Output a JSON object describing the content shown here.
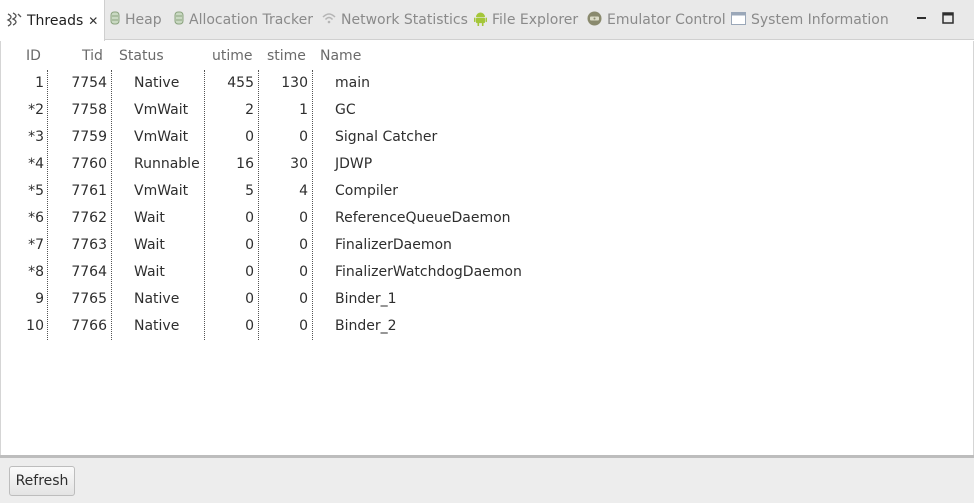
{
  "tabs": [
    {
      "label": "Threads",
      "icon": "threads-icon"
    },
    {
      "label": "Heap",
      "icon": "heap-icon"
    },
    {
      "label": "Allocation Tracker",
      "icon": "allocation-tracker-icon"
    },
    {
      "label": "Network Statistics",
      "icon": "network-statistics-icon"
    },
    {
      "label": "File Explorer",
      "icon": "android-icon"
    },
    {
      "label": "Emulator Control",
      "icon": "emulator-control-icon"
    },
    {
      "label": "System Information",
      "icon": "system-information-icon"
    }
  ],
  "columns": {
    "id": "ID",
    "tid": "Tid",
    "status": "Status",
    "utime": "utime",
    "stime": "stime",
    "name": "Name"
  },
  "rows": [
    {
      "id": "1",
      "tid": "7754",
      "status": "Native",
      "utime": "455",
      "stime": "130",
      "name": "main"
    },
    {
      "id": "*2",
      "tid": "7758",
      "status": "VmWait",
      "utime": "2",
      "stime": "1",
      "name": "GC"
    },
    {
      "id": "*3",
      "tid": "7759",
      "status": "VmWait",
      "utime": "0",
      "stime": "0",
      "name": "Signal Catcher"
    },
    {
      "id": "*4",
      "tid": "7760",
      "status": "Runnable",
      "utime": "16",
      "stime": "30",
      "name": "JDWP"
    },
    {
      "id": "*5",
      "tid": "7761",
      "status": "VmWait",
      "utime": "5",
      "stime": "4",
      "name": "Compiler"
    },
    {
      "id": "*6",
      "tid": "7762",
      "status": "Wait",
      "utime": "0",
      "stime": "0",
      "name": "ReferenceQueueDaemon"
    },
    {
      "id": "*7",
      "tid": "7763",
      "status": "Wait",
      "utime": "0",
      "stime": "0",
      "name": "FinalizerDaemon"
    },
    {
      "id": "*8",
      "tid": "7764",
      "status": "Wait",
      "utime": "0",
      "stime": "0",
      "name": "FinalizerWatchdogDaemon"
    },
    {
      "id": "9",
      "tid": "7765",
      "status": "Native",
      "utime": "0",
      "stime": "0",
      "name": "Binder_1"
    },
    {
      "id": "10",
      "tid": "7766",
      "status": "Native",
      "utime": "0",
      "stime": "0",
      "name": "Binder_2"
    }
  ],
  "footer": {
    "refresh_label": "Refresh"
  }
}
